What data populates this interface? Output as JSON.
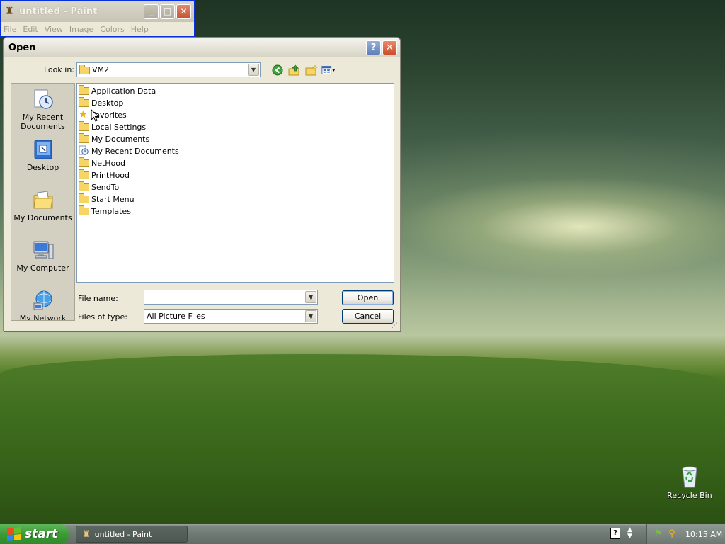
{
  "paint": {
    "title": "untitled - Paint",
    "menu": [
      "File",
      "Edit",
      "View",
      "Image",
      "Colors",
      "Help"
    ],
    "caption_buttons": {
      "minimize": "_",
      "maximize": "□",
      "close": "✕"
    }
  },
  "dialog": {
    "title": "Open",
    "help_button": "?",
    "close_button": "✕",
    "look_in_label": "Look in:",
    "look_in_value": "VM2",
    "places": [
      {
        "label": "My Recent\nDocuments",
        "icon": "recent-documents-icon"
      },
      {
        "label": "Desktop",
        "icon": "desktop-icon"
      },
      {
        "label": "My Documents",
        "icon": "my-documents-icon"
      },
      {
        "label": "My Computer",
        "icon": "my-computer-icon"
      },
      {
        "label": "My Network",
        "icon": "my-network-icon"
      }
    ],
    "files": [
      {
        "name": "Application Data",
        "icon": "folder-icon"
      },
      {
        "name": "Desktop",
        "icon": "folder-icon"
      },
      {
        "name": "Favorites",
        "icon": "favorites-folder-icon"
      },
      {
        "name": "Local Settings",
        "icon": "folder-icon"
      },
      {
        "name": "My Documents",
        "icon": "folder-icon"
      },
      {
        "name": "My Recent Documents",
        "icon": "recent-folder-icon"
      },
      {
        "name": "NetHood",
        "icon": "folder-icon"
      },
      {
        "name": "PrintHood",
        "icon": "folder-icon"
      },
      {
        "name": "SendTo",
        "icon": "folder-icon"
      },
      {
        "name": "Start Menu",
        "icon": "folder-icon"
      },
      {
        "name": "Templates",
        "icon": "folder-icon"
      }
    ],
    "file_name_label": "File name:",
    "file_name_value": "",
    "files_of_type_label": "Files of type:",
    "files_of_type_value": "All Picture Files",
    "open_button": "Open",
    "cancel_button": "Cancel"
  },
  "desktop": {
    "recycle_bin_label": "Recycle Bin"
  },
  "taskbar": {
    "start_label": "start",
    "task_items": [
      {
        "label": "untitled - Paint"
      }
    ],
    "clock": "10:15 AM"
  }
}
